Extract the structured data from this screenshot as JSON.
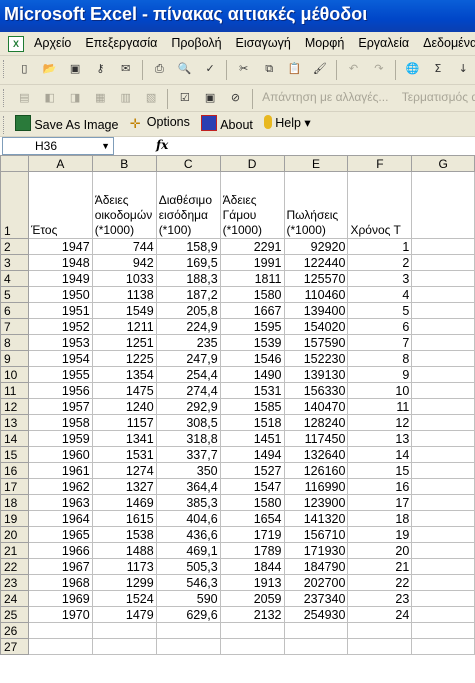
{
  "window": {
    "title": "Microsoft Excel - πίνακας αιτιακές μέθοδοι"
  },
  "menu": [
    "Αρχείο",
    "Επεξεργασία",
    "Προβολή",
    "Εισαγωγή",
    "Μορφή",
    "Εργαλεία",
    "Δεδομένα"
  ],
  "toolbar_review": {
    "reply_label": "Απάντηση με αλλαγές...",
    "end_label": "Τερματισμός αναθ"
  },
  "addin_toolbar": {
    "save_as_image": "Save As Image",
    "options": "Options",
    "about": "About",
    "help": "Help"
  },
  "formula_bar": {
    "name_box": "H36",
    "fx": "fx",
    "formula": ""
  },
  "columns": [
    "A",
    "B",
    "C",
    "D",
    "E",
    "F",
    "G"
  ],
  "headers": [
    "Έτος",
    "Άδειες οικοδομών (*1000)",
    "Διαθέσιμο εισόδημα (*100)",
    "Άδειες Γάμου (*1000)",
    "Πωλήσεις (*1000)",
    "Χρόνος Τ",
    ""
  ],
  "rows": [
    {
      "n": "2",
      "c": [
        "1947",
        "744",
        "158,9",
        "2291",
        "92920",
        "1",
        ""
      ]
    },
    {
      "n": "3",
      "c": [
        "1948",
        "942",
        "169,5",
        "1991",
        "122440",
        "2",
        ""
      ]
    },
    {
      "n": "4",
      "c": [
        "1949",
        "1033",
        "188,3",
        "1811",
        "125570",
        "3",
        ""
      ]
    },
    {
      "n": "5",
      "c": [
        "1950",
        "1138",
        "187,2",
        "1580",
        "110460",
        "4",
        ""
      ]
    },
    {
      "n": "6",
      "c": [
        "1951",
        "1549",
        "205,8",
        "1667",
        "139400",
        "5",
        ""
      ]
    },
    {
      "n": "7",
      "c": [
        "1952",
        "1211",
        "224,9",
        "1595",
        "154020",
        "6",
        ""
      ]
    },
    {
      "n": "8",
      "c": [
        "1953",
        "1251",
        "235",
        "1539",
        "157590",
        "7",
        ""
      ]
    },
    {
      "n": "9",
      "c": [
        "1954",
        "1225",
        "247,9",
        "1546",
        "152230",
        "8",
        ""
      ]
    },
    {
      "n": "10",
      "c": [
        "1955",
        "1354",
        "254,4",
        "1490",
        "139130",
        "9",
        ""
      ]
    },
    {
      "n": "11",
      "c": [
        "1956",
        "1475",
        "274,4",
        "1531",
        "156330",
        "10",
        ""
      ]
    },
    {
      "n": "12",
      "c": [
        "1957",
        "1240",
        "292,9",
        "1585",
        "140470",
        "11",
        ""
      ]
    },
    {
      "n": "13",
      "c": [
        "1958",
        "1157",
        "308,5",
        "1518",
        "128240",
        "12",
        ""
      ]
    },
    {
      "n": "14",
      "c": [
        "1959",
        "1341",
        "318,8",
        "1451",
        "117450",
        "13",
        ""
      ]
    },
    {
      "n": "15",
      "c": [
        "1960",
        "1531",
        "337,7",
        "1494",
        "132640",
        "14",
        ""
      ]
    },
    {
      "n": "16",
      "c": [
        "1961",
        "1274",
        "350",
        "1527",
        "126160",
        "15",
        ""
      ]
    },
    {
      "n": "17",
      "c": [
        "1962",
        "1327",
        "364,4",
        "1547",
        "116990",
        "16",
        ""
      ]
    },
    {
      "n": "18",
      "c": [
        "1963",
        "1469",
        "385,3",
        "1580",
        "123900",
        "17",
        ""
      ]
    },
    {
      "n": "19",
      "c": [
        "1964",
        "1615",
        "404,6",
        "1654",
        "141320",
        "18",
        ""
      ]
    },
    {
      "n": "20",
      "c": [
        "1965",
        "1538",
        "436,6",
        "1719",
        "156710",
        "19",
        ""
      ]
    },
    {
      "n": "21",
      "c": [
        "1966",
        "1488",
        "469,1",
        "1789",
        "171930",
        "20",
        ""
      ]
    },
    {
      "n": "22",
      "c": [
        "1967",
        "1173",
        "505,3",
        "1844",
        "184790",
        "21",
        ""
      ]
    },
    {
      "n": "23",
      "c": [
        "1968",
        "1299",
        "546,3",
        "1913",
        "202700",
        "22",
        ""
      ]
    },
    {
      "n": "24",
      "c": [
        "1969",
        "1524",
        "590",
        "2059",
        "237340",
        "23",
        ""
      ]
    },
    {
      "n": "25",
      "c": [
        "1970",
        "1479",
        "629,6",
        "2132",
        "254930",
        "24",
        ""
      ]
    },
    {
      "n": "26",
      "c": [
        "",
        "",
        "",
        "",
        "",
        "",
        ""
      ]
    },
    {
      "n": "27",
      "c": [
        "",
        "",
        "",
        "",
        "",
        "",
        ""
      ]
    }
  ]
}
